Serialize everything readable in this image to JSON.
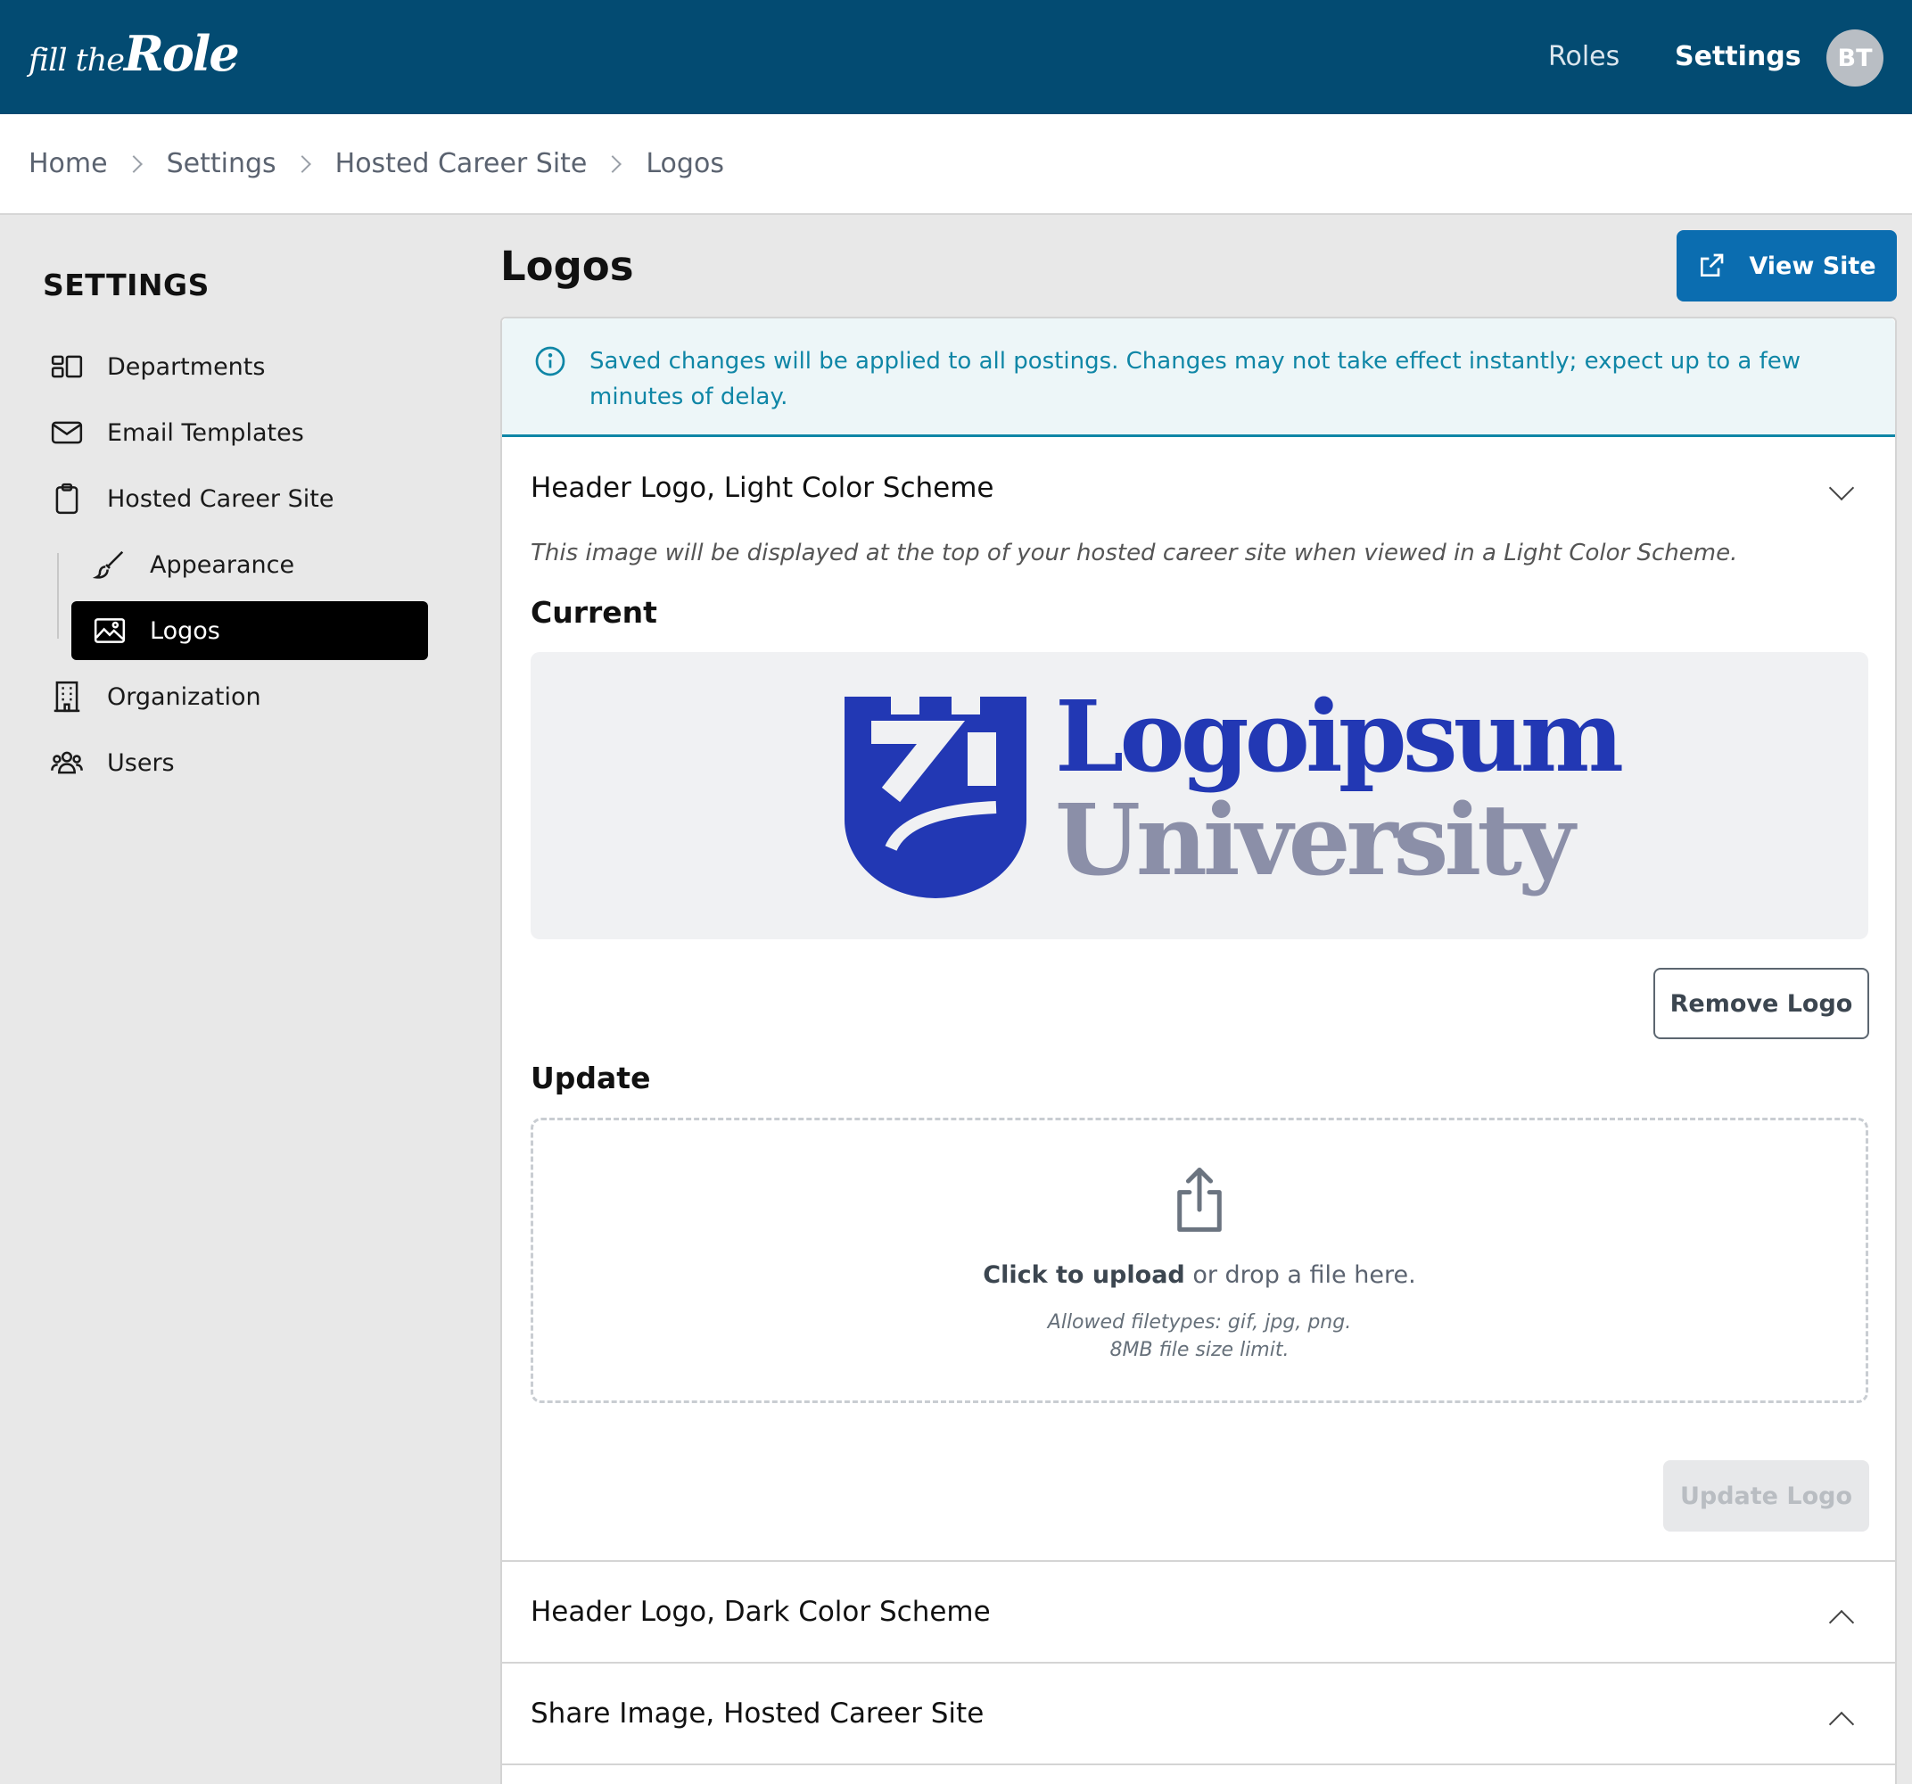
{
  "brand": {
    "small": "fill the",
    "big": "Role"
  },
  "nav": {
    "roles": "Roles",
    "settings": "Settings",
    "avatar_initials": "BT"
  },
  "breadcrumb": [
    "Home",
    "Settings",
    "Hosted Career Site",
    "Logos"
  ],
  "sidebar": {
    "title": "SETTINGS",
    "items": [
      {
        "label": "Departments",
        "icon": "departments-icon"
      },
      {
        "label": "Email Templates",
        "icon": "envelope-icon"
      },
      {
        "label": "Hosted Career Site",
        "icon": "clipboard-icon"
      },
      {
        "label": "Appearance",
        "icon": "paintbrush-icon"
      },
      {
        "label": "Logos",
        "icon": "image-icon",
        "active": true
      },
      {
        "label": "Organization",
        "icon": "building-icon"
      },
      {
        "label": "Users",
        "icon": "users-icon"
      }
    ]
  },
  "main": {
    "title": "Logos",
    "view_site": "View Site",
    "info": "Saved changes will be applied to all postings. Changes may not take effect instantly; expect up to a few minutes of delay.",
    "sections": [
      {
        "heading": "Header Logo, Light Color Scheme",
        "expanded": true,
        "description": "This image will be displayed at the top of your hosted career site when viewed in a Light Color Scheme.",
        "current_label": "Current",
        "logo": {
          "line1": "Logoipsum",
          "line2": "University"
        },
        "remove_label": "Remove Logo",
        "update_label": "Update",
        "upload": {
          "click": "Click to upload",
          "rest": " or drop a file here.",
          "filetypes": "Allowed filetypes: gif, jpg, png.",
          "limit": "8MB file size limit."
        },
        "update_button": "Update Logo"
      },
      {
        "heading": "Header Logo, Dark Color Scheme",
        "expanded": false
      },
      {
        "heading": "Share Image, Hosted Career Site",
        "expanded": false
      }
    ]
  },
  "colors": {
    "topbar": "#034b72",
    "primary_button": "#0b6db0",
    "info_text": "#0f86a6",
    "logo_blue": "#2238b4",
    "logo_gray": "#8b8fa8"
  }
}
